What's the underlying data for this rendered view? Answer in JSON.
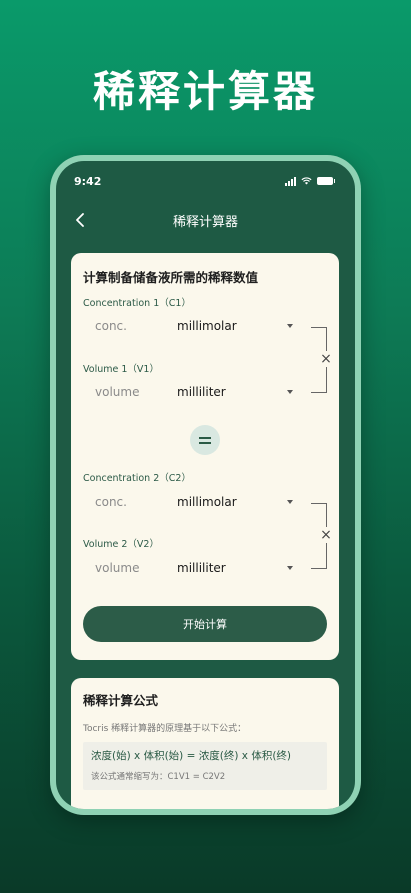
{
  "hero": {
    "title": "稀释计算器"
  },
  "status_bar": {
    "time": "9:42"
  },
  "nav": {
    "title": "稀释计算器",
    "back_icon": "chevron-left-icon"
  },
  "calculator": {
    "heading": "计算制备储备液所需的稀释数值",
    "c1": {
      "label": "Concentration 1（C1）",
      "placeholder": "conc.",
      "unit": "millimolar"
    },
    "v1": {
      "label": "Volume 1（V1）",
      "placeholder": "volume",
      "unit": "milliliter"
    },
    "c2": {
      "label": "Concentration 2（C2）",
      "placeholder": "conc.",
      "unit": "millimolar"
    },
    "v2": {
      "label": "Volume 2（V2）",
      "placeholder": "volume",
      "unit": "milliliter"
    },
    "times_symbol": "×",
    "calculate_button": "开始计算"
  },
  "formula": {
    "title": "稀释计算公式",
    "description": "Tocris 稀释计算器的原理基于以下公式：",
    "equation": "浓度(始) x 体积(始) = 浓度(终) x 体积(终)",
    "note": "该公式通常缩写为：C1V1 = C2V2"
  },
  "colors": {
    "accent": "#2c5c48",
    "card_bg": "#fbf8ec",
    "screen_bg": "#1e5a44"
  }
}
